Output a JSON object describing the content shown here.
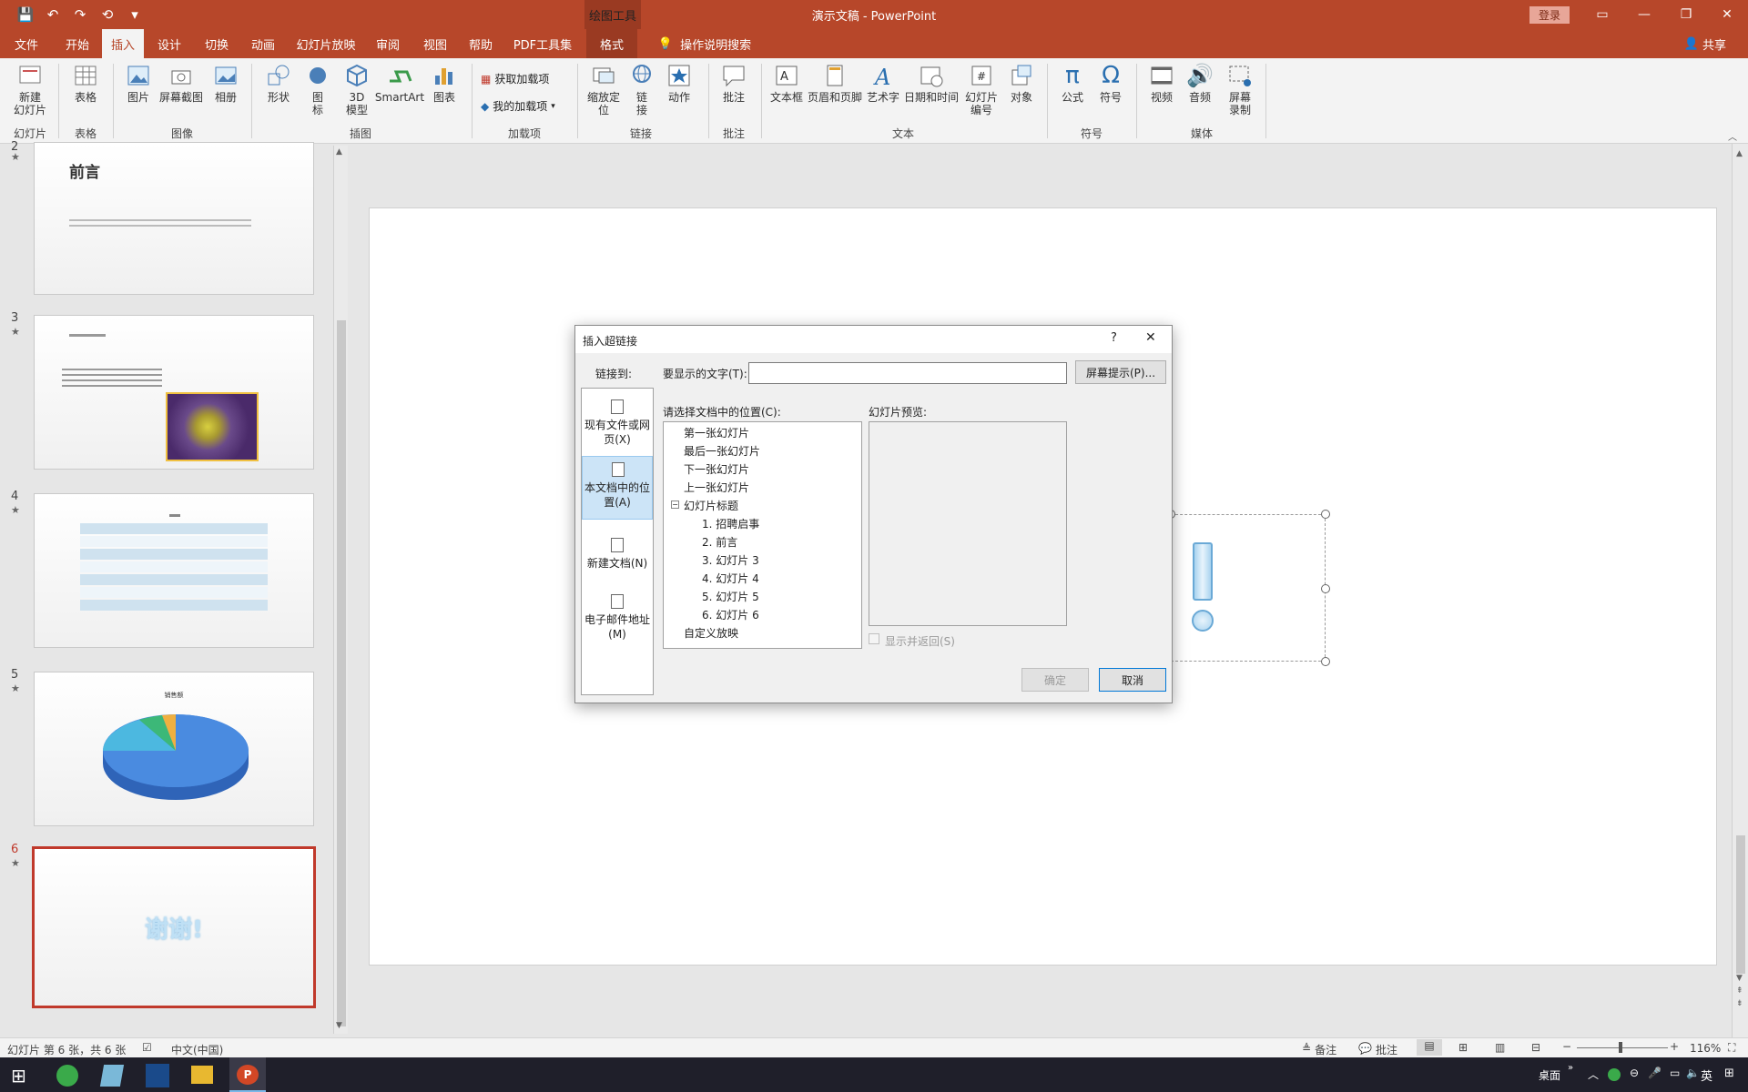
{
  "titlebar": {
    "qat": [
      "💾",
      "↶",
      "↷",
      "⟲",
      "▾"
    ],
    "context_tool": "绘图工具",
    "title": "演示文稿  -  PowerPoint",
    "login": "登录"
  },
  "tabs": [
    "文件",
    "开始",
    "插入",
    "设计",
    "切换",
    "动画",
    "幻灯片放映",
    "审阅",
    "视图",
    "帮助",
    "PDF工具集",
    "格式"
  ],
  "tell_me": "操作说明搜索",
  "share": "共享",
  "ribbon": {
    "new_slide": "新建\n幻灯片",
    "table": "表格",
    "picture": "图片",
    "screenshot": "屏幕截图",
    "album": "相册",
    "shapes": "形状",
    "icons": "图\n标",
    "model3d": "3D\n模型",
    "smartart": "SmartArt",
    "chart": "图表",
    "get_addins": "获取加载项",
    "my_addins": "我的加载项",
    "zoom": "缩放定\n位",
    "link": "链\n接",
    "action": "动作",
    "comment": "批注",
    "textbox": "文本框",
    "header_footer": "页眉和页脚",
    "wordart": "艺术字",
    "datetime": "日期和时间",
    "slide_number": "幻灯片\n编号",
    "object": "对象",
    "equation": "公式",
    "symbol": "符号",
    "video": "视频",
    "audio": "音频",
    "screen_record": "屏幕\n录制",
    "groups": {
      "slides": "幻灯片",
      "tables": "表格",
      "images": "图像",
      "illustrations": "插图",
      "addins": "加载项",
      "links": "链接",
      "comments": "批注",
      "text": "文本",
      "symbols": "符号",
      "media": "媒体"
    }
  },
  "thumbnails": {
    "t2_title": "前言",
    "t3_num": "3",
    "t4_num": "4",
    "t5_num": "5",
    "t5_title": "销售额",
    "t6_num": "6",
    "t6_text": "谢谢!",
    "partial_num": "2"
  },
  "statusbar": {
    "slide_info": "幻灯片 第 6 张，共 6 张",
    "language": "中文(中国)",
    "notes": "备注",
    "comments": "批注",
    "zoom": "116%"
  },
  "taskbar": {
    "desktop": "桌面",
    "ime": "英"
  },
  "dialog": {
    "title": "插入超链接",
    "help": "?",
    "close": "✕",
    "link_to_label": "链接到:",
    "display_text_label": "要显示的文字(T):",
    "display_text_value": "",
    "screentip_button": "屏幕提示(P)...",
    "link_options": [
      {
        "label": "现有文件或网\n页(X)"
      },
      {
        "label": "本文档中的位\n置(A)"
      },
      {
        "label": "新建文档(N)"
      },
      {
        "label": "电子邮件地址\n(M)"
      }
    ],
    "place_label": "请选择文档中的位置(C):",
    "tree": {
      "first": "第一张幻灯片",
      "last": "最后一张幻灯片",
      "next": "下一张幻灯片",
      "prev": "上一张幻灯片",
      "titles": "幻灯片标题",
      "s1": "1. 招聘启事",
      "s2": "2. 前言",
      "s3": "3. 幻灯片 3",
      "s4": "4. 幻灯片 4",
      "s5": "5. 幻灯片 5",
      "s6": "6. 幻灯片 6",
      "custom": "自定义放映"
    },
    "preview_label": "幻灯片预览:",
    "show_return": "显示并返回(S)",
    "ok": "确定",
    "cancel": "取消"
  }
}
